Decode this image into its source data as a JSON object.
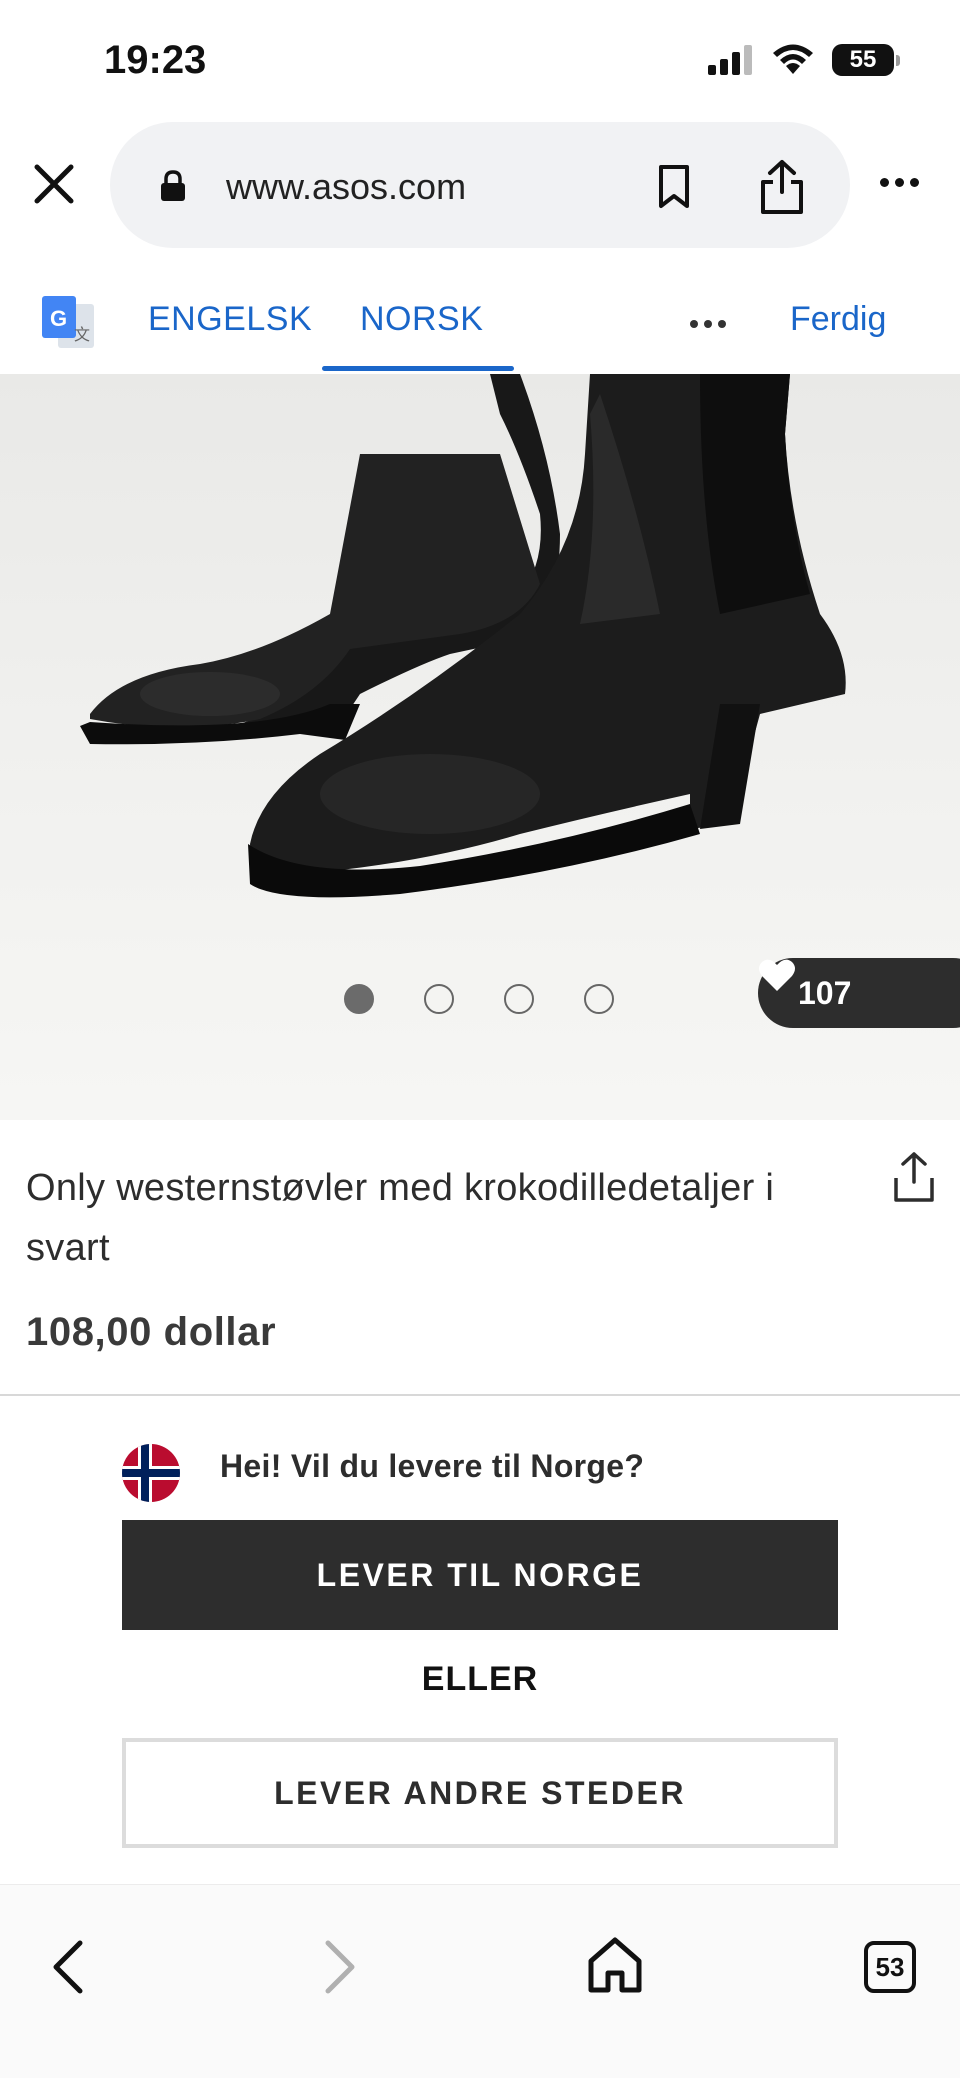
{
  "status_bar": {
    "time": "19:23",
    "battery": "55"
  },
  "browser": {
    "url": "www.asos.com"
  },
  "translate": {
    "lang_from": "ENGELSK",
    "lang_to": "NORSK",
    "done": "Ferdig",
    "active": "NORSK"
  },
  "product": {
    "title": "Only westernstøvler med krokodilledetaljer i svart",
    "price": "108,00 dollar",
    "likes": "107",
    "gallery_images": 4,
    "gallery_active": 1
  },
  "delivery": {
    "question": "Hei! Vil du levere til Norge?",
    "primary_label": "LEVER TIL NORGE",
    "or_label": "ELLER",
    "secondary_label": "LEVER ANDRE STEDER"
  },
  "toolbar": {
    "tab_count": "53"
  },
  "colors": {
    "link_blue": "#1a66c9",
    "dark": "#2d2d2d"
  },
  "icons": [
    "close-icon",
    "lock-icon",
    "bookmark-icon",
    "share-icon",
    "more-icon",
    "google-translate-icon",
    "heart-icon",
    "norway-flag-icon",
    "back-icon",
    "forward-icon",
    "home-icon",
    "tabs-icon"
  ]
}
